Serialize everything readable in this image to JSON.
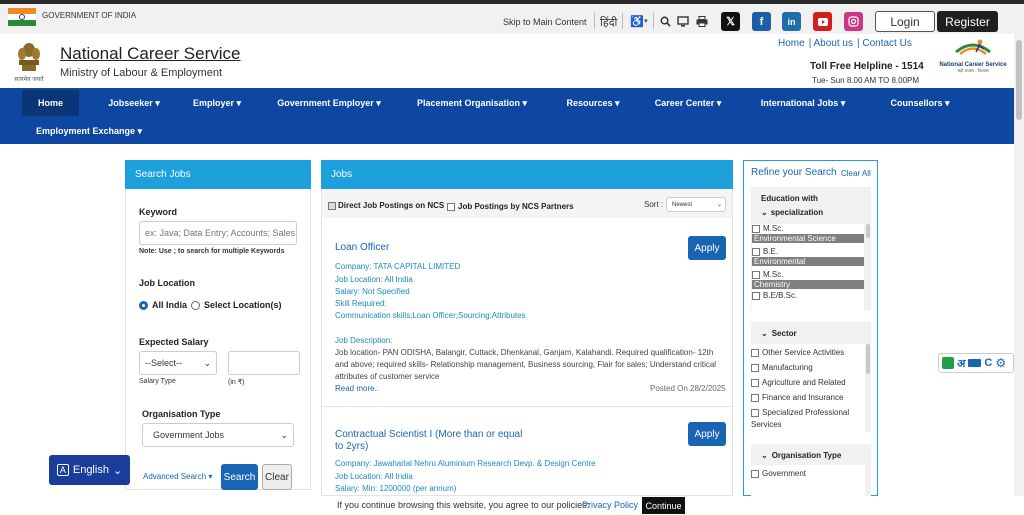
{
  "topbar": {
    "govt_label": "GOVERNMENT OF INDIA",
    "skip_link": "Skip to Main Content",
    "hindi_link": "हिंदी",
    "login": "Login",
    "register": "Register"
  },
  "header": {
    "title": "National Career Service",
    "subtitle": "Ministry of Labour & Employment",
    "emblem_caption": "सत्यमेव जयते",
    "links": [
      "Home",
      "| About us",
      "| Contact Us"
    ],
    "helpline": "Toll Free Helpline - 1514",
    "hours": "Tue- Sun 8.00 AM TO 8.00PM",
    "logo_text": "National Career Service",
    "logo_sub": "सही अवसर - विश्वास"
  },
  "nav": {
    "items": [
      "Home",
      "Jobseeker ▾",
      "Employer ▾",
      "Government Employer ▾",
      "Placement Organisation ▾",
      "Resources ▾",
      "Career Center ▾",
      "International Jobs ▾",
      "Counsellors ▾"
    ],
    "row2": [
      "Employment Exchange ▾"
    ]
  },
  "search": {
    "title": "Search Jobs",
    "keyword_label": "Keyword",
    "keyword_placeholder": "ex: Java; Data Entry; Accounts; Sales",
    "keyword_note": "Note: Use ; to search for multiple Keywords",
    "location_label": "Job Location",
    "loc_all": "All India",
    "loc_select": "Select Location(s)",
    "salary_label": "Expected Salary",
    "salary_select": "--Select--",
    "salary_type": "Salary Type",
    "salary_unit": "(in ₹)",
    "org_label": "Organisation Type",
    "org_value": "Government Jobs",
    "advanced": "Advanced Search",
    "search_btn": "Search",
    "clear_btn": "Clear"
  },
  "jobs": {
    "title": "Jobs",
    "filter_direct": "Direct Job Postings on NCS",
    "filter_partners": "Job Postings by NCS Partners",
    "sort_label": "Sort :",
    "sort_value": "Newest",
    "apply": "Apply",
    "job1": {
      "title": "Loan Officer",
      "company": "Company: TATA CAPITAL LIMITED",
      "location": "Job Location: All India",
      "salary": "Salary: Not Specified",
      "skill_label": "Skill Required:",
      "skills": "Communication skills;Loan Officer;Sourcing;Attributes",
      "desc_label": "Job Description:",
      "desc1": "Job location- PAN ODISHA, Balangir, Cuttack, Dhenkanal, Ganjam, Kalahandi. Required qualification- 12th",
      "desc2": "and above; required skills- Relationship management, Business sourcing, Flair for sales; Understand critical",
      "desc3": "attributes of customer service",
      "read_more": "Read more..",
      "posted": "Posted On 28/2/2025"
    },
    "job2": {
      "title1": "Contractual Scientist I (More than or equal",
      "title2": "to 2yrs)",
      "company": "Company: Jawaharlal Nehru Aluminium Research Devp. & Design Centre",
      "location": "Job Location: All India",
      "salary": "Salary: Min: 1200000 (per annum)"
    }
  },
  "refine": {
    "title": "Refine your Search",
    "clear_all": "Clear All",
    "education_title1": "Education with",
    "education_title2": "specialization",
    "edu_items": [
      {
        "degree": "M.Sc.",
        "spec": "Environmental Science"
      },
      {
        "degree": "B.E.",
        "spec": "Environmental"
      },
      {
        "degree": "M.Sc.",
        "spec": "Chemistry"
      },
      {
        "degree": "B.E/B.Sc.",
        "spec": ""
      }
    ],
    "sector_title": "Sector",
    "sectors": [
      "Other Service Activities",
      "Manufacturing",
      "Agriculture and Related",
      "Finance and Insurance",
      "Specialized Professional",
      "Services"
    ],
    "org_title": "Organisation Type",
    "orgs": [
      "Government"
    ]
  },
  "language": {
    "label": "English"
  },
  "translate_widget": {
    "letters": "अ",
    "c": "C"
  },
  "cookie": {
    "text": "If you continue browsing this website, you agree to our policies:",
    "policy": "Privacy Policy",
    "continue": "Continue"
  },
  "colors": {
    "nav": "#0d47a1",
    "panel_head": "#1ea0dc",
    "link": "#1a64b4"
  }
}
